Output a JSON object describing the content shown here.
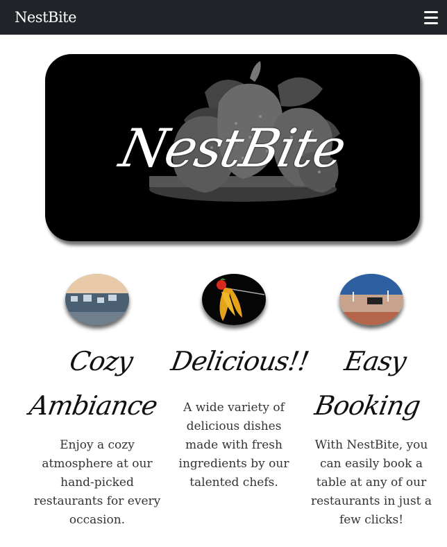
{
  "navbar": {
    "brand": "NestBite",
    "menu_icon": "hamburger-menu-icon"
  },
  "hero": {
    "logo_text": "NestBite",
    "illustration": "strawberries-on-plate"
  },
  "features": [
    {
      "title": "Cozy Ambiance",
      "text": "Enjoy a cozy atmosphere at our hand-picked restaurants for every occasion.",
      "image": "restaurant-interior-photo"
    },
    {
      "title": "Delicious!!",
      "text": "A wide variety of delicious dishes made with fresh ingredients by our talented chefs.",
      "image": "pasta-on-fork-photo"
    },
    {
      "title": "Easy Booking",
      "text": "With NestBite, you can easily book a table at any of our restaurants in just a few clicks!",
      "image": "table-setting-photo"
    }
  ],
  "colors": {
    "navbar_bg": "#212529",
    "hero_bg": "#000000",
    "page_bg": "#ffffff"
  }
}
